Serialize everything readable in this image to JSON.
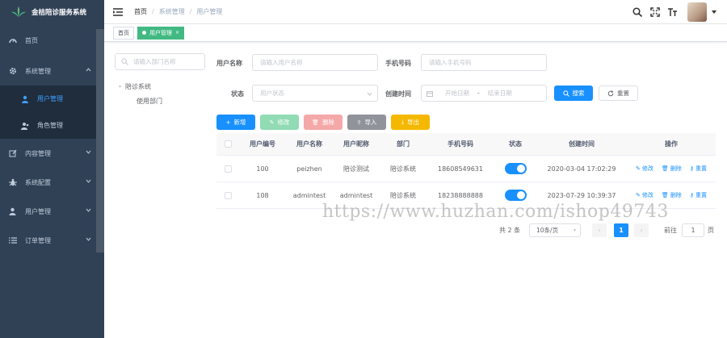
{
  "app": {
    "title": "金桔陪诊服务系统"
  },
  "sidebar": {
    "items": [
      {
        "label": "首页",
        "icon": "dashboard-icon"
      },
      {
        "label": "系统管理",
        "icon": "gear-icon",
        "children": [
          {
            "label": "用户管理",
            "icon": "user-icon",
            "active": true
          },
          {
            "label": "角色管理",
            "icon": "role-icon"
          }
        ]
      },
      {
        "label": "内容管理",
        "icon": "edit-icon"
      },
      {
        "label": "系统配置",
        "icon": "bug-icon"
      },
      {
        "label": "用户管理",
        "icon": "user-icon"
      },
      {
        "label": "订单管理",
        "icon": "list-icon"
      }
    ]
  },
  "breadcrumb": [
    "首页",
    "系统管理",
    "用户管理"
  ],
  "tags": [
    {
      "label": "首页",
      "active": false
    },
    {
      "label": "用户管理",
      "active": true
    }
  ],
  "dept": {
    "search_placeholder": "请输入部门名称",
    "root": "陪诊系统",
    "child": "使用部门"
  },
  "filters": {
    "username_label": "用户名称",
    "username_placeholder": "请输入用户名称",
    "phone_label": "手机号码",
    "phone_placeholder": "请输入手机号码",
    "status_label": "状态",
    "status_placeholder": "用户状态",
    "time_label": "创建时间",
    "start_placeholder": "开始日期",
    "range_sep": "-",
    "end_placeholder": "结束日期",
    "search_btn": "搜索",
    "reset_btn": "重置"
  },
  "toolbar": {
    "add": "新增",
    "edit": "修改",
    "delete": "删除",
    "import": "导入",
    "export": "导出"
  },
  "table": {
    "headers": [
      "用户编号",
      "用户名称",
      "用户昵称",
      "部门",
      "手机号码",
      "状态",
      "创建时间",
      "操作"
    ],
    "rows": [
      {
        "id": "100",
        "name": "peizhen",
        "nick": "陪诊测试",
        "dept": "陪诊系统",
        "phone": "18608549631",
        "status": true,
        "created": "2020-03-04 17:02:29"
      },
      {
        "id": "108",
        "name": "admintest",
        "nick": "admintest",
        "dept": "陪诊系统",
        "phone": "18238888888",
        "status": true,
        "created": "2023-07-29 10:39:37"
      }
    ],
    "ops": {
      "edit": "修改",
      "delete": "删除",
      "reset": "重置"
    }
  },
  "pagination": {
    "total": "共 2 条",
    "page_size": "10条/页",
    "current": "1",
    "goto_label": "前往",
    "goto_value": "1",
    "page_suffix": "页"
  },
  "watermark": "https://www.huzhan.com/ishop49743",
  "colors": {
    "sidebar": "#304156",
    "primary": "#1890ff",
    "tag_active": "#42b983"
  }
}
